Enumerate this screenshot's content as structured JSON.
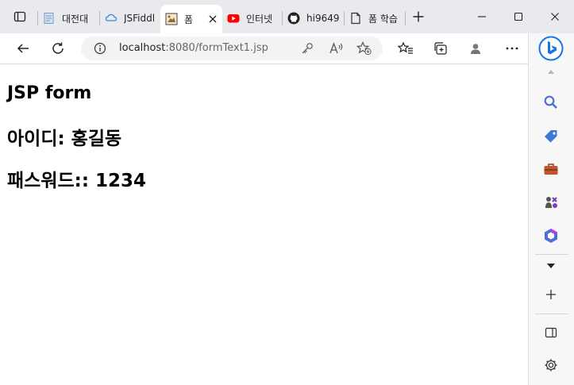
{
  "browser": {
    "tabs": [
      {
        "label": "대전대",
        "icon": "document-icon"
      },
      {
        "label": "JSFiddl",
        "icon": "jsfiddle-icon"
      },
      {
        "label": "폼",
        "icon": "image-icon",
        "active": true
      },
      {
        "label": "인터넷",
        "icon": "youtube-icon"
      },
      {
        "label": "hi9649",
        "icon": "github-icon"
      },
      {
        "label": "폼 학습",
        "icon": "page-icon"
      }
    ],
    "address_host": "localhost",
    "address_path": ":8080/formText1.jsp"
  },
  "page": {
    "heading": "JSP form",
    "id_line": "아이디: 홍길동",
    "pw_line": "패스워드:: 1234"
  },
  "colors": {
    "bing": "#1a73e8",
    "youtube": "#ff0000"
  }
}
